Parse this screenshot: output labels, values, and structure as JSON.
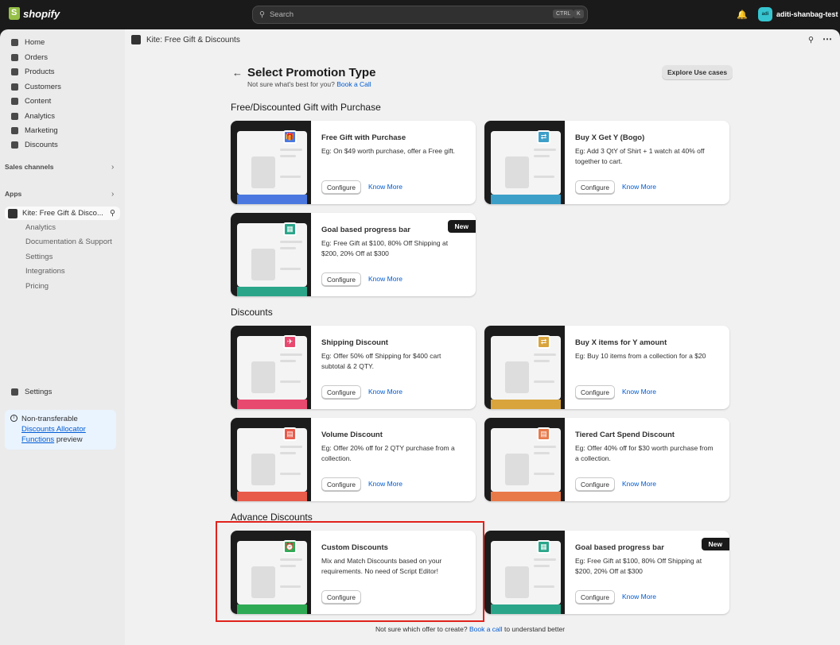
{
  "topbar": {
    "brand": "shopify",
    "search_placeholder": "Search",
    "kbd1": "CTRL",
    "kbd2": "K",
    "store_avatar": "adi",
    "store_name": "aditi-shanbag-test"
  },
  "sidebar": {
    "nav": [
      "Home",
      "Orders",
      "Products",
      "Customers",
      "Content",
      "Analytics",
      "Marketing",
      "Discounts"
    ],
    "sales_channels": "Sales channels",
    "apps": "Apps",
    "app_name": "Kite: Free Gift & Disco...",
    "app_sub": [
      "Analytics",
      "Documentation & Support",
      "Settings",
      "Integrations",
      "Pricing"
    ],
    "settings": "Settings",
    "notice_1": "Non-transferable",
    "notice_link": "Discounts Allocator Functions",
    "notice_2": "preview"
  },
  "app_header": "Kite: Free Gift & Discounts",
  "page": {
    "title": "Select Promotion Type",
    "subtitle": "Not sure what's best for you?",
    "subtitle_link": "Book a Call",
    "explore": "Explore Use cases"
  },
  "sections": {
    "s1": "Free/Discounted Gift with Purchase",
    "s2": "Discounts",
    "s3": "Advance Discounts"
  },
  "labels": {
    "configure": "Configure",
    "know_more": "Know More",
    "new": "New"
  },
  "cards": [
    {
      "title": "Free Gift with Purchase",
      "desc": "Eg: On $49 worth purchase, offer a Free gift.",
      "color": "#4a78e0"
    },
    {
      "title": "Buy X Get Y (Bogo)",
      "desc": "Eg: Add 3 QtY of Shirt + 1 watch at 40% off together to cart.",
      "color": "#3c9fc8"
    },
    {
      "title": "Goal based progress bar",
      "desc": "Eg: Free Gift at $100, 80% Off Shipping at $200, 20% Off at $300",
      "color": "#2aa58a"
    },
    {
      "title": "Shipping Discount",
      "desc": "Eg: Offer 50% off Shipping for $400 cart subtotal & 2 QTY.",
      "color": "#e8496f"
    },
    {
      "title": "Buy X items for Y amount",
      "desc": "Eg: Buy 10 items from a collection for a $20",
      "color": "#d9a43c"
    },
    {
      "title": "Volume Discount",
      "desc": "Eg: Offer 20% off for 2 QTY purchase from a collection.",
      "color": "#e85a4a"
    },
    {
      "title": "Tiered Cart Spend Discount",
      "desc": "Eg: Offer 40% off for $30 worth purchase from a collection.",
      "color": "#e87a4a"
    },
    {
      "title": "Custom Discounts",
      "desc": "Mix and Match Discounts based on your requirements. No need of Script Editor!",
      "color": "#2eaa55"
    },
    {
      "title": "Goal based progress bar",
      "desc": "Eg: Free Gift at $100, 80% Off Shipping at $200, 20% Off at $300",
      "color": "#2aa58a"
    }
  ],
  "footer": {
    "text1": "Not sure which offer to create?",
    "link": "Book a call",
    "text2": "to understand better"
  }
}
